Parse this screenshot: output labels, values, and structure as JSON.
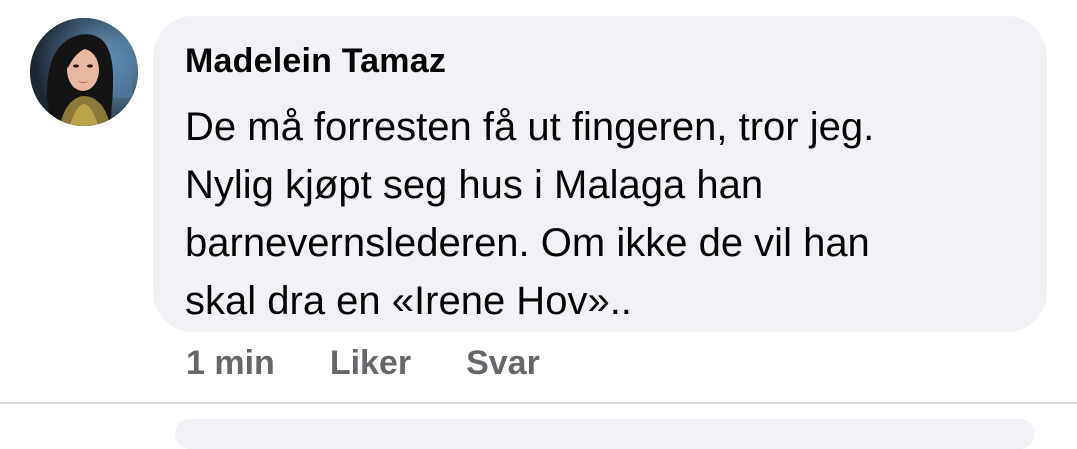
{
  "comment": {
    "author": "Madelein Tamaz",
    "lines": [
      "De må forresten få ut fingeren, tror jeg.",
      "Nylig kjøpt seg hus i Malaga han",
      "barnevernslederen. Om ikke de vil han",
      "skal dra en «Irene Hov».."
    ],
    "timestamp": "1 min",
    "like_label": "Liker",
    "reply_label": "Svar"
  },
  "colors": {
    "bubble_bg": "#f0f2f5",
    "text": "#050505",
    "meta": "#65676b",
    "divider": "#dadde1"
  }
}
